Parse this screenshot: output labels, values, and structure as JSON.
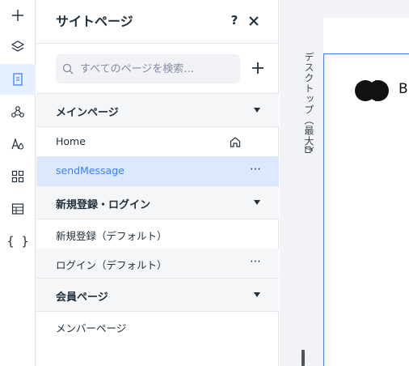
{
  "rail": {
    "items": [
      {
        "icon": "plus-icon"
      },
      {
        "icon": "layers-icon"
      },
      {
        "icon": "pages-icon",
        "active": true
      },
      {
        "icon": "connect-icon"
      },
      {
        "icon": "theme-icon"
      },
      {
        "icon": "apps-icon"
      },
      {
        "icon": "table-icon"
      },
      {
        "icon": "code-icon",
        "glyph": "{ }"
      }
    ]
  },
  "panel": {
    "title": "サイトページ",
    "help_label": "?",
    "search": {
      "placeholder": "すべてのページを検索..."
    },
    "groups": [
      {
        "label": "メインページ",
        "pages": [
          {
            "label": "Home",
            "home": true
          },
          {
            "label": "sendMessage",
            "selected": true,
            "more": "⋯"
          }
        ]
      },
      {
        "label": "新規登録・ログイン",
        "pages": [
          {
            "label": "新規登録（デフォルト）"
          },
          {
            "label": "ログイン（デフォルト）",
            "more": "⋯"
          }
        ]
      },
      {
        "label": "会員ページ",
        "pages": [
          {
            "label": "メンバーページ"
          }
        ]
      }
    ]
  },
  "canvas": {
    "device_label": "デスクトップ（最大）",
    "logo_text": "B"
  },
  "colors": {
    "accent": "#3b82f6",
    "selected_bg": "#dbe8fd",
    "group_bg": "#f5f6f8"
  }
}
